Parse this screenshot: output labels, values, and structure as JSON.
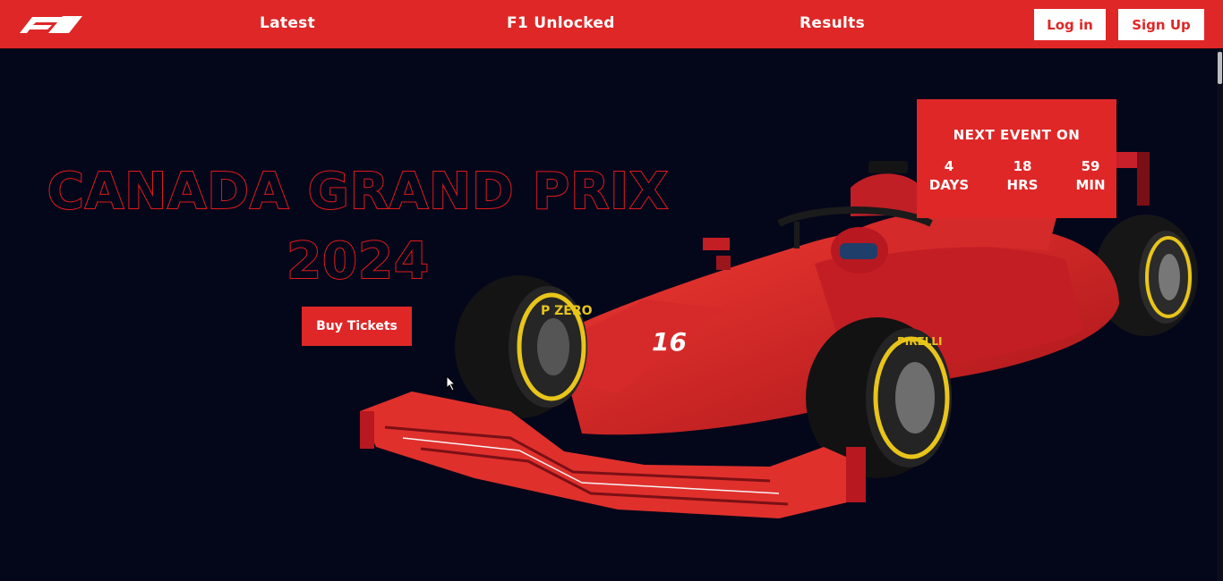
{
  "nav": {
    "links": [
      "Latest",
      "F1 Unlocked",
      "Results"
    ],
    "login_label": "Log in",
    "signup_label": "Sign Up",
    "logo_icon": "f1-logo-icon"
  },
  "hero": {
    "title_line1": "CANADA GRAND PRIX",
    "title_line2": "2024",
    "buy_label": "Buy Tickets"
  },
  "next_event": {
    "heading": "NEXT EVENT ON",
    "countdown": [
      {
        "value": "4",
        "unit": "DAYS"
      },
      {
        "value": "18",
        "unit": "HRS"
      },
      {
        "value": "59",
        "unit": "MIN"
      }
    ]
  },
  "car": {
    "number": "16",
    "tyre_brand": "PIRELLI",
    "tyre_label": "P ZERO"
  },
  "colors": {
    "accent": "#df2727",
    "background": "#04071a",
    "tyre_stripe": "#e8c51a"
  }
}
